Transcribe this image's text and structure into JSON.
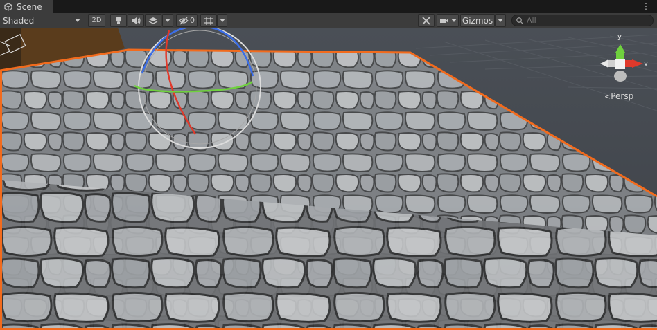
{
  "tab": {
    "title": "Scene",
    "icon": "scene-icon",
    "menu_glyph": "⋮"
  },
  "toolbar": {
    "shading_mode": "Shaded",
    "toggle_2d": "2D",
    "hidden_count": "0",
    "gizmos_label": "Gizmos",
    "search_placeholder": "All"
  },
  "viewport": {
    "projection_label": "Persp",
    "axis_labels": {
      "y": "y",
      "x": "x"
    },
    "selection_outline_color": "#f26b1d",
    "axis_colors": {
      "x": "#e0392b",
      "y": "#6fd13e",
      "z": "#3b6ee8"
    }
  }
}
